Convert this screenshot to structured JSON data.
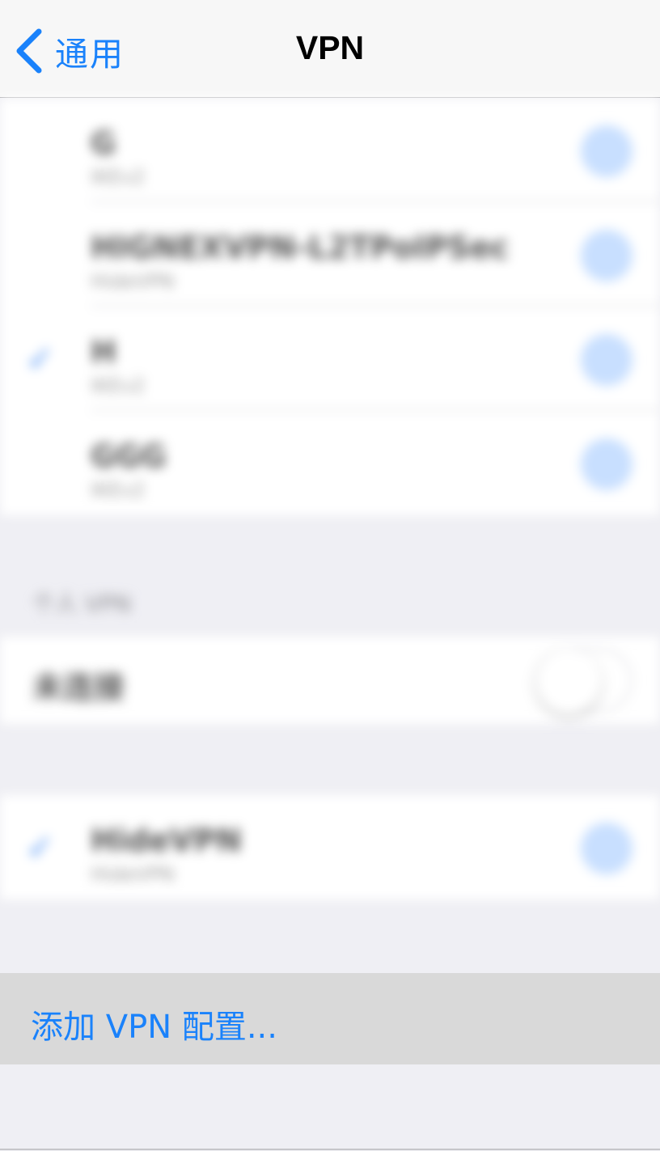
{
  "nav": {
    "back_label": "通用",
    "title": "VPN"
  },
  "vpn_configs": [
    {
      "name": "G",
      "type": "IKEv2",
      "selected": false
    },
    {
      "name": "HIGNEXVPN-L2TPoIPSec",
      "type": "HideVPN",
      "selected": false
    },
    {
      "name": "H",
      "type": "IKEv2",
      "selected": true
    },
    {
      "name": "GGG",
      "type": "IKEv2",
      "selected": false
    }
  ],
  "personal_section": {
    "header": "个人 VPN",
    "status_label": "未连接",
    "toggle_on": false
  },
  "personal_vpn": {
    "name": "HideVPN",
    "type": "HideVPN",
    "selected": true
  },
  "add_row": {
    "label": "添加 VPN 配置..."
  },
  "colors": {
    "accent": "#1a82fb",
    "background": "#efeff4",
    "add_row_bg": "#d9d9d9"
  }
}
